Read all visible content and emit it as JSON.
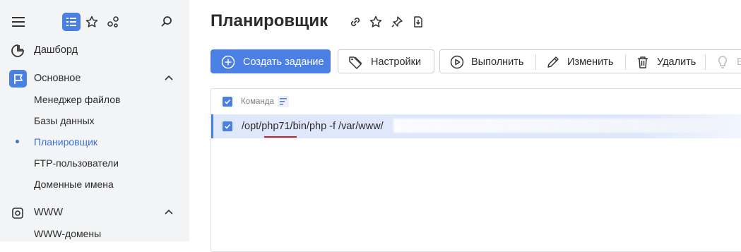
{
  "sidebar": {
    "icons": [
      "menu-icon",
      "list-icon",
      "star-icon",
      "dots-icon",
      "search-icon"
    ],
    "items": [
      {
        "label": "Дашборд",
        "icon": "dashboard-icon"
      },
      {
        "label": "Основное",
        "icon": "flag-icon",
        "expanded": true
      },
      {
        "label": "WWW",
        "icon": "gear-icon",
        "expanded": true
      }
    ],
    "sub_main": [
      "Менеджер файлов",
      "Базы данных",
      "Планировщик",
      "FTP-пользователи",
      "Доменные имена"
    ],
    "sub_www": [
      "WWW-домены"
    ],
    "active": "Планировщик",
    "accent": "#4a7fe3"
  },
  "page": {
    "title": "Планировщик",
    "title_icons": [
      "link-icon",
      "star-icon",
      "pin-icon",
      "download-icon"
    ]
  },
  "toolbar": {
    "create": "Создать задание",
    "settings": "Настройки",
    "run": "Выполнить",
    "edit": "Изменить",
    "delete": "Удалить",
    "more": "В"
  },
  "table": {
    "columns": [
      "Команда"
    ],
    "rows": [
      {
        "command": "/opt/php71/bin/php -f /var/www/",
        "selected": true
      }
    ]
  }
}
